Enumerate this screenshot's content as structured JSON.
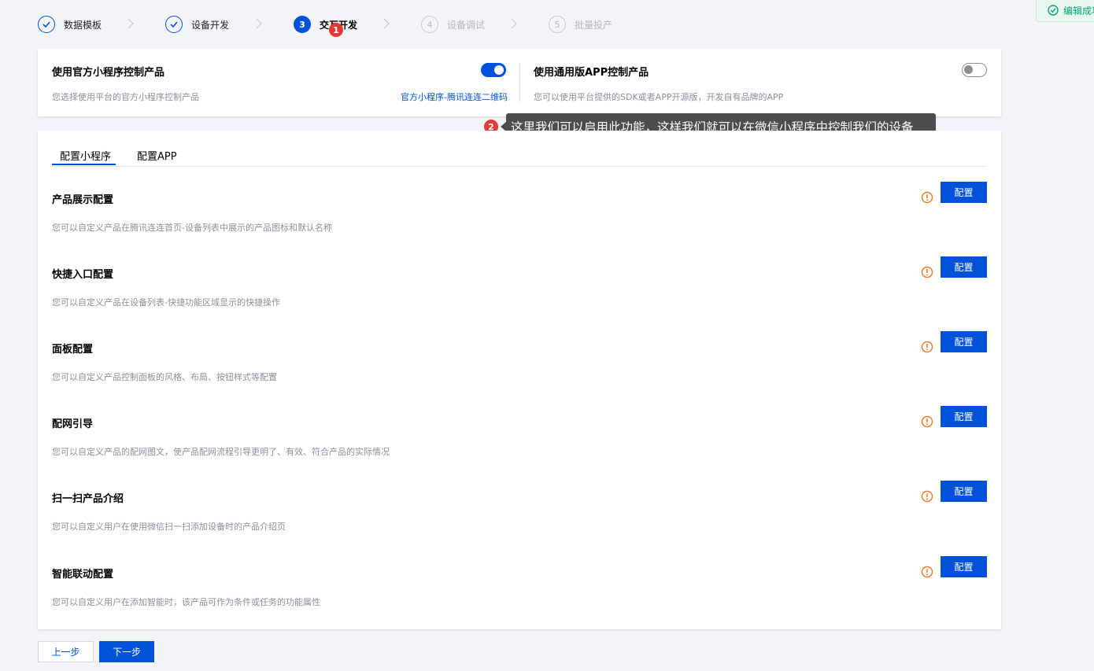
{
  "steps": [
    {
      "num": "1",
      "label": "数据模板",
      "state": "done"
    },
    {
      "num": "2",
      "label": "设备开发",
      "state": "done"
    },
    {
      "num": "3",
      "label": "交互开发",
      "state": "active"
    },
    {
      "num": "4",
      "label": "设备调试",
      "state": "todo"
    },
    {
      "num": "5",
      "label": "批量投产",
      "state": "todo"
    }
  ],
  "markers": {
    "m1": "1",
    "m2": "2"
  },
  "toast": {
    "text": "编辑成功",
    "color": "#00a870"
  },
  "options": {
    "mini": {
      "title": "使用官方小程序控制产品",
      "desc": "您选择使用平台的官方小程序控制产品",
      "link": "官方小程序-腾讯连连二维码",
      "enabled": true
    },
    "app": {
      "title": "使用通用版APP控制产品",
      "desc": "您可以使用平台提供的SDK或者APP开源版，开发自有品牌的APP",
      "enabled": false
    }
  },
  "tooltip": "这里我们可以启用此功能，这样我们就可以在微信小程序中控制我们的设备",
  "tabs": [
    {
      "label": "配置小程序",
      "active": true
    },
    {
      "label": "配置APP",
      "active": false
    }
  ],
  "config_items": [
    {
      "title": "产品展示配置",
      "desc": "您可以自定义产品在腾讯连连首页-设备列表中展示的产品图标和默认名称",
      "button": "配置"
    },
    {
      "title": "快捷入口配置",
      "desc": "您可以自定义产品在设备列表-快捷功能区域显示的快捷操作",
      "button": "配置"
    },
    {
      "title": "面板配置",
      "desc": "您可以自定义产品控制面板的风格、布局、按钮样式等配置",
      "button": "配置"
    },
    {
      "title": "配网引导",
      "desc": "您可以自定义产品的配网图文，使产品配网流程引导更明了、有效、符合产品的实际情况",
      "button": "配置"
    },
    {
      "title": "扫一扫产品介绍",
      "desc": "您可以自定义用户在使用微信扫一扫添加设备时的产品介绍页",
      "button": "配置"
    },
    {
      "title": "智能联动配置",
      "desc": "您可以自定义用户在添加智能时，该产品可作为条件或任务的功能属性",
      "button": "配置"
    }
  ],
  "footer": {
    "prev": "上一步",
    "next": "下一步"
  },
  "colors": {
    "primary": "#0052d9",
    "warning": "#ed7b2f",
    "marker": "#e53935"
  }
}
